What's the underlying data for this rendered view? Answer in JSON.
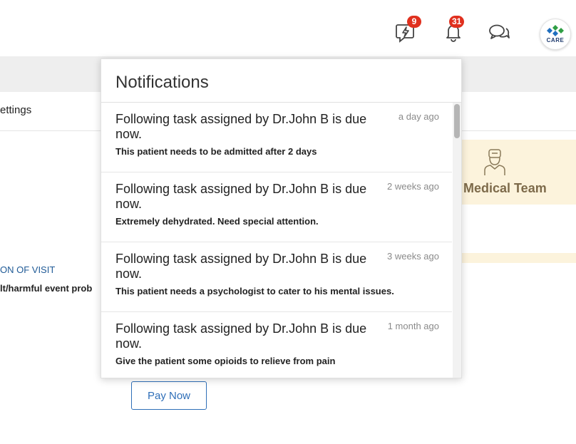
{
  "topbar": {
    "activity_badge": "9",
    "bell_badge": "31",
    "avatar_text": "CARE"
  },
  "page": {
    "settings_tab": "ettings",
    "card_label": "Medical Team",
    "visit_label": "ON OF VISIT",
    "visit_text": "lt/harmful event prob",
    "pay_button": "Pay Now"
  },
  "notifications": {
    "title": "Notifications",
    "items": [
      {
        "title": "Following task assigned by Dr.John B is due now.",
        "time": "a day ago",
        "body": "This patient needs to be admitted after 2 days"
      },
      {
        "title": "Following task assigned by Dr.John B is due now.",
        "time": "2 weeks ago",
        "body": "Extremely dehydrated. Need special attention."
      },
      {
        "title": "Following task assigned by Dr.John B is due now.",
        "time": "3 weeks ago",
        "body": "This patient needs a psychologist to cater to his mental issues."
      },
      {
        "title": "Following task assigned by Dr.John B is due now.",
        "time": "1 month ago",
        "body": "Give the patient some opioids to relieve from pain"
      }
    ]
  },
  "icons": {
    "activity": "lightning-chat-icon",
    "bell": "bell-icon",
    "chat": "chat-bubbles-icon",
    "medical_team": "doctor-icon"
  }
}
